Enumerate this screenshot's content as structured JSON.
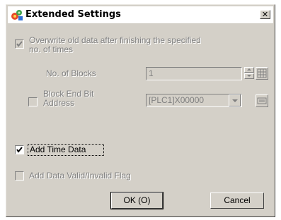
{
  "window": {
    "title": "Extended Settings",
    "close_glyph": "✕"
  },
  "overwrite": {
    "label_line1": "Overwrite old data after finishing the specified",
    "label_line2": "no. of times",
    "checked": true,
    "enabled": false
  },
  "blocks": {
    "label": "No. of Blocks",
    "value": "1"
  },
  "block_end": {
    "label_line1": "Block End Bit",
    "label_line2": "Address",
    "value": "[PLC1]X00000",
    "checked": false
  },
  "add_time": {
    "label": "Add Time Data",
    "checked": true
  },
  "add_flag": {
    "label": "Add Data Valid/Invalid Flag",
    "checked": false,
    "enabled": false
  },
  "buttons": {
    "ok": "OK (O)",
    "ok_mnemonic": "O",
    "cancel": "Cancel"
  },
  "colors": {
    "face": "#d4d0c8",
    "disabled_text": "#808080"
  }
}
